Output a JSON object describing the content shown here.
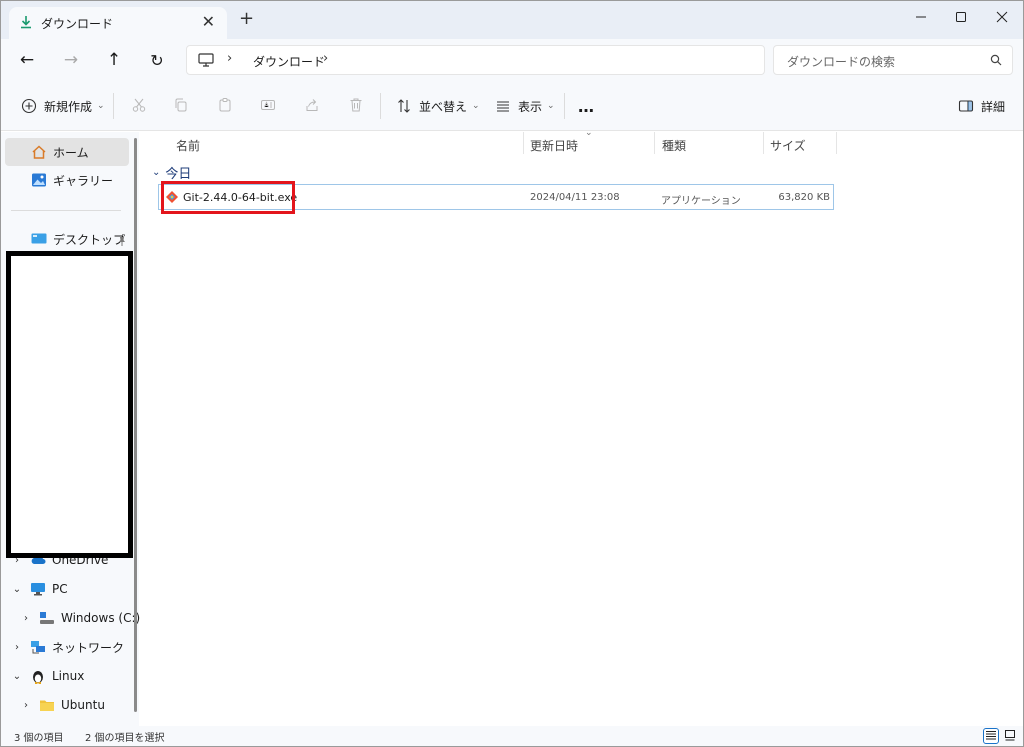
{
  "tab": {
    "title": "ダウンロード",
    "close": "✕",
    "add": "+"
  },
  "window_controls": {
    "minimize": "—",
    "maximize": "☐",
    "close": "✕"
  },
  "nav": {
    "back": "←",
    "forward": "→",
    "up": "↑",
    "refresh": "↻"
  },
  "address": {
    "sep": "›",
    "path": "ダウンロード"
  },
  "search": {
    "placeholder": "ダウンロードの検索"
  },
  "toolbar": {
    "new_label": "新規作成",
    "sort_label": "並べ替え",
    "view_label": "表示",
    "more_label": "…",
    "details_label": "詳細",
    "chevron": "⌄"
  },
  "sidebar": {
    "home": "ホーム",
    "gallery": "ギャラリー",
    "desktop": "デスクトップ",
    "onedrive": "OneDrive",
    "pc": "PC",
    "windows": "Windows (C:)",
    "network": "ネットワーク",
    "linux": "Linux",
    "ubuntu": "Ubuntu",
    "chevron_right": "›",
    "chevron_down": "⌄"
  },
  "columns": {
    "name": "名前",
    "date": "更新日時",
    "type": "種類",
    "size": "サイズ"
  },
  "group": {
    "label": "今日",
    "chevron": "⌄"
  },
  "files": [
    {
      "name": "Git-2.44.0-64-bit.exe",
      "date": "2024/04/11 23:08",
      "type": "アプリケーション",
      "size": "63,820 KB"
    }
  ],
  "status": {
    "count": "3 個の項目",
    "selected": "2 個の項目を選択"
  },
  "colors": {
    "highlight": "#e3151c",
    "accent": "#1a73c9",
    "group": "#1f3d7a"
  }
}
